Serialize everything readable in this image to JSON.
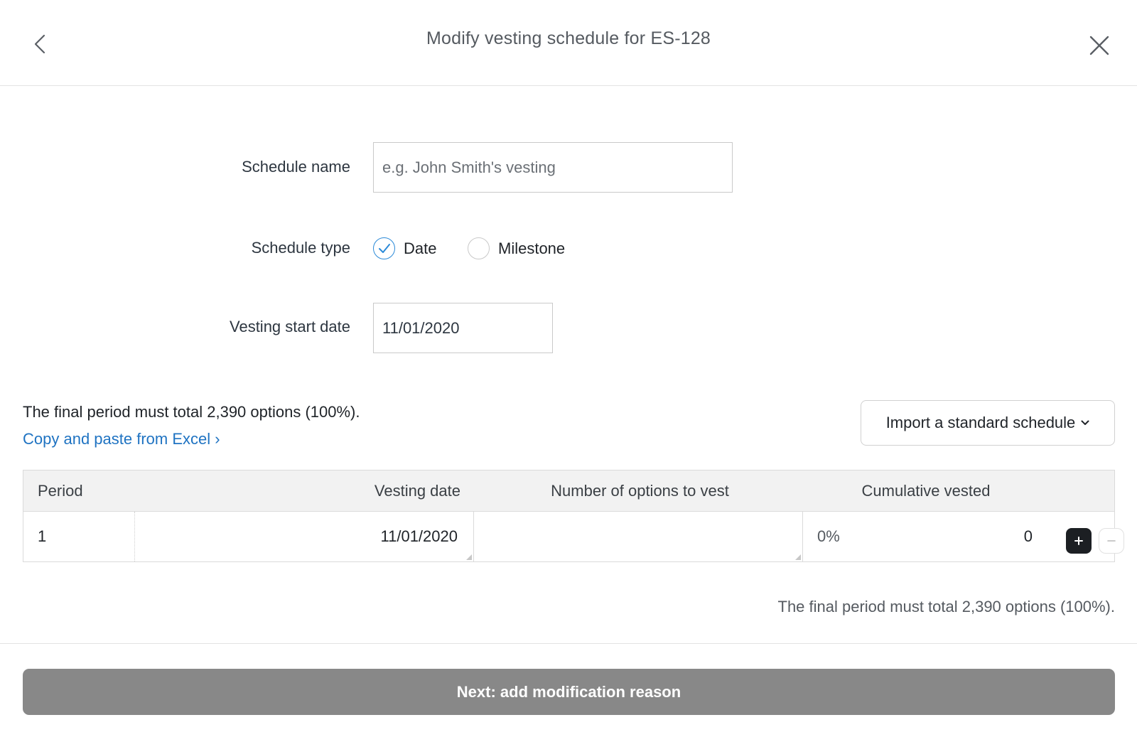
{
  "header": {
    "title": "Modify vesting schedule for ES-128",
    "back_icon": "chevron-left-icon",
    "close_icon": "close-icon"
  },
  "form": {
    "schedule_name": {
      "label": "Schedule name",
      "value": "",
      "placeholder": "e.g. John Smith's vesting"
    },
    "schedule_type": {
      "label": "Schedule type",
      "options": [
        {
          "label": "Date",
          "checked": true
        },
        {
          "label": "Milestone",
          "checked": false
        }
      ]
    },
    "vesting_start_date": {
      "label": "Vesting start date",
      "value": "11/01/2020"
    }
  },
  "schedule": {
    "requirement_text": "The final period must total 2,390 options (100%).",
    "excel_link": "Copy and paste from Excel ›",
    "import_button": "Import a standard schedule",
    "columns": [
      "Period",
      "Vesting date",
      "Number of options to vest",
      "Cumulative vested"
    ],
    "rows": [
      {
        "period": "1",
        "vesting_date": "11/01/2020",
        "options": "",
        "cumulative_percent": "0%",
        "cumulative_count": "0"
      }
    ],
    "footer_text": "The final period must total 2,390 options (100%)."
  },
  "footer": {
    "next_button": "Next: add modification reason"
  },
  "colors": {
    "accent_blue": "#2b8ad8",
    "link_blue": "#1f73c2",
    "disabled_button": "#888888",
    "dark_button": "#1c1f23"
  }
}
